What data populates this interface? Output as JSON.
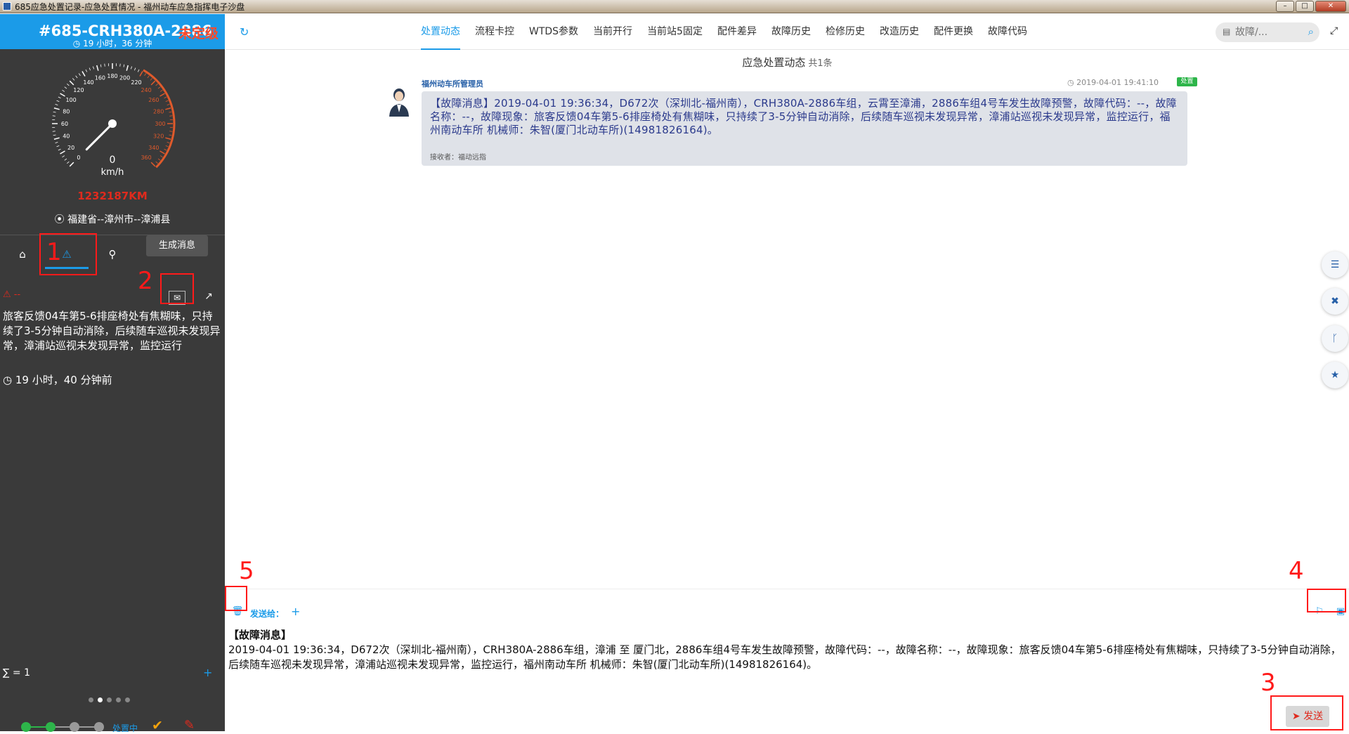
{
  "window": {
    "title": "685应急处置记录-应急处置情况 - 福州动车应急指挥电子沙盘"
  },
  "left": {
    "train_title": "#685-CRH380A-2886",
    "train_level": "未定级",
    "elapsed": "19 小时，36 分钟",
    "gauge": {
      "ticks": [
        "0",
        "20",
        "40",
        "60",
        "80",
        "100",
        "120",
        "140",
        "160",
        "180",
        "200",
        "220",
        "240",
        "260",
        "280",
        "300",
        "320",
        "340",
        "360"
      ],
      "speed": "0",
      "unit": "km/h",
      "speed_value": 0
    },
    "odometer": "1232187KM",
    "location": "福建省--漳州市--漳浦县",
    "tooltip": "生成消息",
    "alert_label": "--",
    "fault_text": "旅客反馈04车第5-6排座椅处有焦糊味，只持续了3-5分钟自动消除，后续随车巡视未发现异常，漳浦站巡视未发现异常，监控运行",
    "fault_time": "19 小时，40 分钟前",
    "sum": "∑ = 1",
    "status_label": "处置中",
    "progress_steps_done": 2,
    "progress_steps_total": 4
  },
  "main": {
    "nav": [
      {
        "label": "处置动态",
        "active": true
      },
      {
        "label": "流程卡控",
        "active": false
      },
      {
        "label": "WTDS参数",
        "active": false
      },
      {
        "label": "当前开行",
        "active": false
      },
      {
        "label": "当前站5固定",
        "active": false
      },
      {
        "label": "配件差异",
        "active": false
      },
      {
        "label": "故障历史",
        "active": false
      },
      {
        "label": "检修历史",
        "active": false
      },
      {
        "label": "改造历史",
        "active": false
      },
      {
        "label": "配件更换",
        "active": false
      },
      {
        "label": "故障代码",
        "active": false
      }
    ],
    "search_placeholder": "故障/...",
    "feed_title": "应急处置动态",
    "feed_count": "共1条",
    "message": {
      "sender": "福州动车所管理员",
      "time": "2019-04-01 19:41:10",
      "badge": "处置",
      "text": "【故障消息】2019-04-01 19:36:34，D672次（深圳北-福州南），CRH380A-2886车组，云霄至漳浦，2886车组4号车发生故障预警，故障代码：--，故障名称：--，故障现象：旅客反馈04车第5-6排座椅处有焦糊味，只持续了3-5分钟自动消除，后续随车巡视未发现异常，漳浦站巡视未发现异常，监控运行，福州南动车所 机械师：朱智(厦门北动车所)(14981826164)。",
      "recipient": "接收者：福动远指"
    },
    "compose": {
      "send_to_label": "发送给：",
      "title": "【故障消息】",
      "body": "2019-04-01 19:36:34，D672次（深圳北-福州南），CRH380A-2886车组，漳浦 至 厦门北，2886车组4号车发生故障预警，故障代码：--，故障名称：--，故障现象：旅客反馈04车第5-6排座椅处有焦糊味，只持续了3-5分钟自动消除，后续随车巡视未发现异常，漳浦站巡视未发现异常，监控运行，福州南动车所 机械师：朱智(厦门北动车所)(14981826164)。",
      "send_label": "发送"
    }
  },
  "annotations": [
    "1",
    "2",
    "3",
    "4",
    "5"
  ],
  "colors": {
    "accent": "#1b9be8",
    "alert": "#e02a1d",
    "panel": "#3a3a3a",
    "success": "#2db54a"
  }
}
